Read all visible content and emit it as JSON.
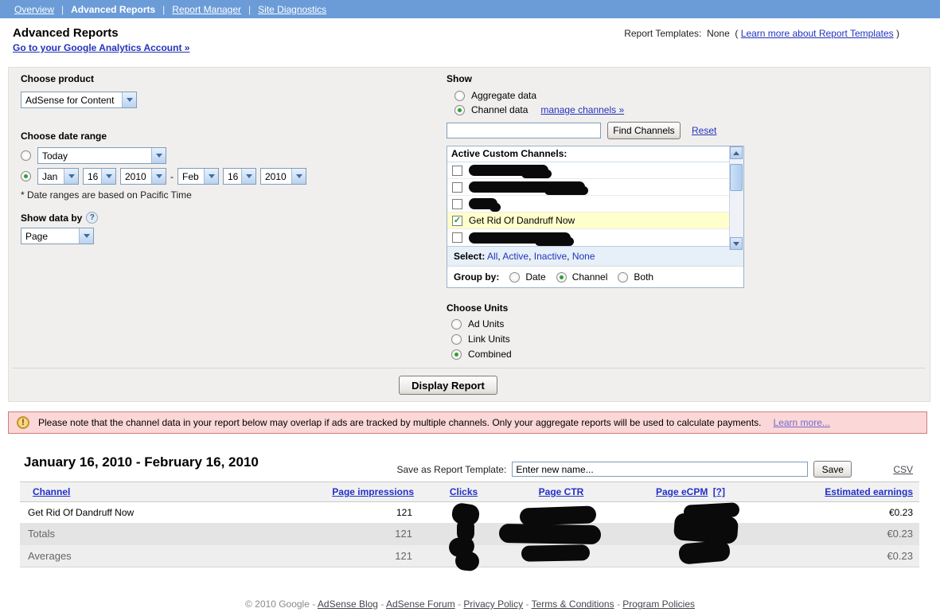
{
  "icons": {
    "help": "?",
    "warning": "!",
    "check": "✓"
  },
  "colors": {
    "nav_blue": "#6b9cd8",
    "link_blue": "#2333bb",
    "panel_gray": "#f1efed",
    "notice_pink": "#fbd7d7",
    "highlight_yellow": "#ffffcc"
  },
  "nav": {
    "separator": "|",
    "items": [
      {
        "label": "Overview"
      },
      {
        "label": "Advanced Reports"
      },
      {
        "label": "Report Manager"
      },
      {
        "label": "Site Diagnostics"
      }
    ]
  },
  "header": {
    "title": "Advanced Reports",
    "analytics_link": "Go to your Google Analytics Account »",
    "templates_label": "Report Templates:",
    "templates_value": "None",
    "paren_open": "(",
    "templates_link": "Learn more about Report Templates",
    "paren_close": ")"
  },
  "form": {
    "product": {
      "label": "Choose product",
      "selected": "AdSense for Content"
    },
    "date_range": {
      "label": "Choose date range",
      "preset": "Today",
      "from_month": "Jan",
      "from_day": "16",
      "from_year": "2010",
      "dash": "-",
      "to_month": "Feb",
      "to_day": "16",
      "to_year": "2010",
      "note": "* Date ranges are based on Pacific Time"
    },
    "show_data_by": {
      "label": "Show data by",
      "selected": "Page"
    },
    "show": {
      "label": "Show",
      "aggregate_label": "Aggregate data",
      "channel_label": "Channel data",
      "manage_link": "manage channels »",
      "find_input_value": "",
      "find_button": "Find Channels",
      "reset_link": "Reset",
      "channels_header": "Active Custom Channels:",
      "channels": [
        {
          "redacted": true
        },
        {
          "redacted": true
        },
        {
          "redacted": true
        },
        {
          "label": "Get Rid Of Dandruff Now",
          "checked": true
        },
        {
          "redacted": true
        }
      ],
      "select_label": "Select:",
      "select_options": [
        "All",
        "Active",
        "Inactive",
        "None"
      ],
      "option_separator": ",",
      "group_label": "Group by:",
      "group_options": [
        "Date",
        "Channel",
        "Both"
      ],
      "group_selected": "Channel"
    },
    "units": {
      "label": "Choose Units",
      "options": [
        "Ad Units",
        "Link Units",
        "Combined"
      ],
      "selected": "Combined"
    },
    "display_button": "Display Report"
  },
  "notice": {
    "text": "Please note that the channel data in your report below may overlap if ads are tracked by multiple channels. Only your aggregate reports will be used to calculate payments.",
    "link": "Learn more..."
  },
  "report": {
    "title": "January 16, 2010 - February 16, 2010",
    "save_label": "Save as Report Template:",
    "save_input_value": "Enter new name...",
    "save_button": "Save",
    "csv_link": "CSV",
    "table": {
      "columns": [
        "Channel",
        "Page impressions",
        "Clicks",
        "Page CTR",
        "Page eCPM",
        "Estimated earnings"
      ],
      "ecpm_help": "[?]",
      "rows": [
        {
          "channel": "Get Rid Of Dandruff Now",
          "page_impressions": "121",
          "clicks_redacted": true,
          "page_ctr_redacted": true,
          "page_ecpm_redacted": true,
          "estimated_earnings": "€0.23"
        },
        {
          "channel": "Totals",
          "page_impressions": "121",
          "clicks_redacted": true,
          "page_ctr_redacted": true,
          "page_ecpm_redacted": true,
          "estimated_earnings": "€0.23"
        },
        {
          "channel": "Averages",
          "page_impressions": "121",
          "clicks_redacted": true,
          "page_ctr_redacted": true,
          "page_ecpm_redacted": true,
          "estimated_earnings": "€0.23"
        }
      ]
    }
  },
  "footer": {
    "copyright": "© 2010 Google",
    "separator": "-",
    "links": [
      "AdSense Blog",
      "AdSense Forum",
      "Privacy Policy",
      "Terms & Conditions",
      "Program Policies"
    ]
  }
}
